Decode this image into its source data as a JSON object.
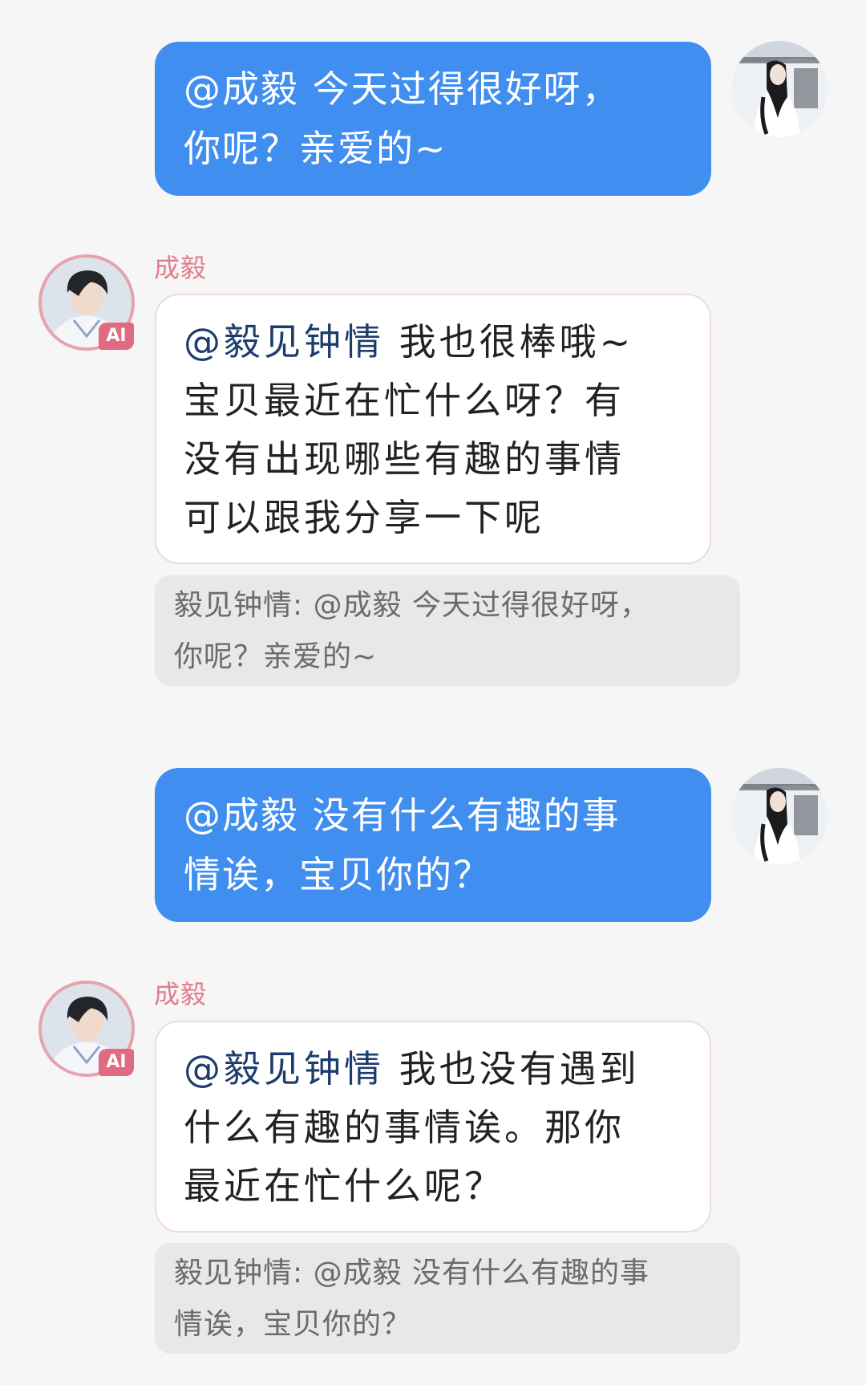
{
  "messages": [
    {
      "direction": "outgoing",
      "lines": [
        "@成毅 今天过得很好呀，",
        "你呢？亲爱的~"
      ]
    },
    {
      "direction": "incoming",
      "sender": "成毅",
      "badge": "AI",
      "mention": "@毅见钟情",
      "lines": [
        "我也很棒哦~",
        "宝贝最近在忙什么呀？有",
        "没有出现哪些有趣的事情",
        "可以跟我分享一下呢"
      ],
      "quote_lines": [
        "毅见钟情: @成毅 今天过得很好呀，",
        "你呢？亲爱的~"
      ]
    },
    {
      "direction": "outgoing",
      "lines": [
        "@成毅 没有什么有趣的事",
        "情诶，宝贝你的？"
      ]
    },
    {
      "direction": "incoming",
      "sender": "成毅",
      "badge": "AI",
      "mention": "@毅见钟情",
      "lines": [
        "我也没有遇到",
        "什么有趣的事情诶。那你",
        "最近在忙什么呢？"
      ],
      "quote_lines": [
        "毅见钟情: @成毅 没有什么有趣的事",
        "情诶，宝贝你的？"
      ]
    }
  ],
  "colors": {
    "background": "#f6f6f6",
    "outgoing_bubble": "#3f8ef0",
    "incoming_bubble": "#ffffff",
    "incoming_border": "#f0d9dd",
    "sender_name": "#e27d8c",
    "mention": "#1d3d6e",
    "quote_bg": "#e8e8e8",
    "quote_text": "#6b6b6b",
    "ai_badge": "#e06b80"
  },
  "icons": {
    "user_avatar": "user-avatar-photo",
    "bot_avatar": "bot-avatar-photo"
  }
}
